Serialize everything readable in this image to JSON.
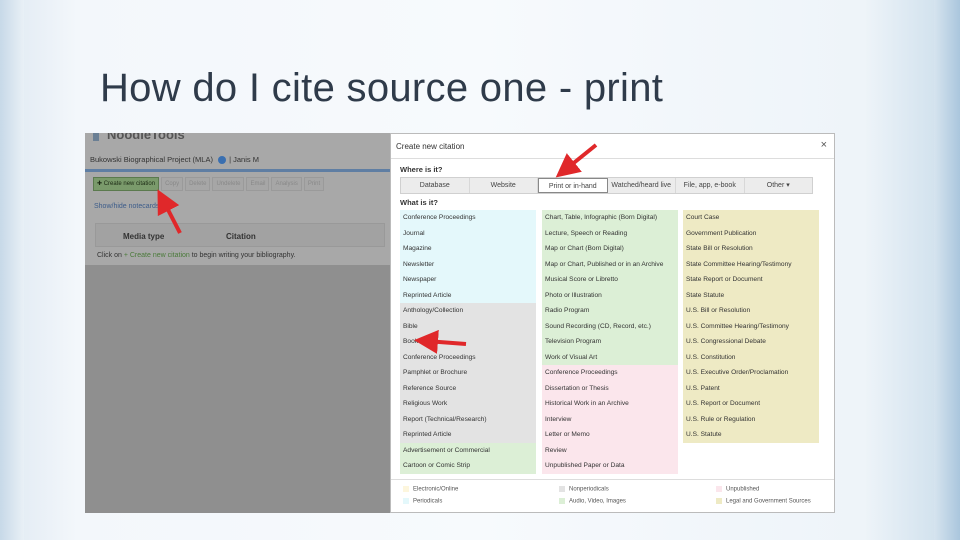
{
  "slide": {
    "title": "How do I cite source one - print"
  },
  "app": {
    "logo": "NoodleTools",
    "project": "Bukowski Biographical Project (MLA)",
    "user": "Janis M",
    "toolbar": [
      "Create new citation",
      "Copy",
      "Delete",
      "Undelete",
      "Email",
      "Analysis",
      "Print"
    ],
    "show_hide": "Show/hide notecards",
    "columns": [
      "Media type",
      "Citation"
    ],
    "hint_before": "Click on ",
    "hint_link": "+ Create new citation",
    "hint_after": " to begin writing your bibliography."
  },
  "dialog": {
    "title": "Create new citation",
    "q_where": "Where is it?",
    "q_what": "What is it?",
    "tabs": [
      "Database",
      "Website",
      "Print or in-hand",
      "Watched/heard live",
      "File, app, e-book",
      "Other ▾"
    ],
    "active_tab": "Print or in-hand",
    "col1": [
      {
        "t": "Conference Proceedings",
        "c": "peri"
      },
      {
        "t": "Journal",
        "c": "peri"
      },
      {
        "t": "Magazine",
        "c": "peri"
      },
      {
        "t": "Newsletter",
        "c": "peri"
      },
      {
        "t": "Newspaper",
        "c": "peri"
      },
      {
        "t": "Reprinted Article",
        "c": "peri"
      },
      {
        "t": "Anthology/Collection",
        "c": "nonp"
      },
      {
        "t": "Bible",
        "c": "nonp"
      },
      {
        "t": "Book",
        "c": "nonp"
      },
      {
        "t": "Conference Proceedings",
        "c": "nonp"
      },
      {
        "t": "Pamphlet or Brochure",
        "c": "nonp"
      },
      {
        "t": "Reference Source",
        "c": "nonp"
      },
      {
        "t": "Religious Work",
        "c": "nonp"
      },
      {
        "t": "Report (Technical/Research)",
        "c": "nonp"
      },
      {
        "t": "Reprinted Article",
        "c": "nonp"
      },
      {
        "t": "Advertisement or Commercial",
        "c": "audio"
      },
      {
        "t": "Cartoon or Comic Strip",
        "c": "audio"
      }
    ],
    "col2": [
      {
        "t": "Chart, Table, Infographic (Born Digital)",
        "c": "audio"
      },
      {
        "t": "Lecture, Speech or Reading",
        "c": "audio"
      },
      {
        "t": "Map or Chart (Born Digital)",
        "c": "audio"
      },
      {
        "t": "Map or Chart, Published or in an Archive",
        "c": "audio"
      },
      {
        "t": "Musical Score or Libretto",
        "c": "audio"
      },
      {
        "t": "Photo or Illustration",
        "c": "audio"
      },
      {
        "t": "Radio Program",
        "c": "audio"
      },
      {
        "t": "Sound Recording (CD, Record, etc.)",
        "c": "audio"
      },
      {
        "t": "Television Program",
        "c": "audio"
      },
      {
        "t": "Work of Visual Art",
        "c": "audio"
      },
      {
        "t": "Conference Proceedings",
        "c": "unpub"
      },
      {
        "t": "Dissertation or Thesis",
        "c": "unpub"
      },
      {
        "t": "Historical Work in an Archive",
        "c": "unpub"
      },
      {
        "t": "Interview",
        "c": "unpub"
      },
      {
        "t": "Letter or Memo",
        "c": "unpub"
      },
      {
        "t": "Review",
        "c": "unpub"
      },
      {
        "t": "Unpublished Paper or Data",
        "c": "unpub"
      }
    ],
    "col3": [
      {
        "t": "Court Case",
        "c": "legal"
      },
      {
        "t": "Government Publication",
        "c": "legal"
      },
      {
        "t": "State Bill or Resolution",
        "c": "legal"
      },
      {
        "t": "State Committee Hearing/Testimony",
        "c": "legal"
      },
      {
        "t": "State Report or Document",
        "c": "legal"
      },
      {
        "t": "State Statute",
        "c": "legal"
      },
      {
        "t": "U.S. Bill or Resolution",
        "c": "legal"
      },
      {
        "t": "U.S. Committee Hearing/Testimony",
        "c": "legal"
      },
      {
        "t": "U.S. Congressional Debate",
        "c": "legal"
      },
      {
        "t": "U.S. Constitution",
        "c": "legal"
      },
      {
        "t": "U.S. Executive Order/Proclamation",
        "c": "legal"
      },
      {
        "t": "U.S. Patent",
        "c": "legal"
      },
      {
        "t": "U.S. Report or Document",
        "c": "legal"
      },
      {
        "t": "U.S. Rule or Regulation",
        "c": "legal"
      },
      {
        "t": "U.S. Statute",
        "c": "legal"
      }
    ],
    "legend": {
      "electronic": "Electronic/Online",
      "periodicals": "Periodicals",
      "nonperiodicals": "Nonperiodicals",
      "audio": "Audio, Video, Images",
      "unpublished": "Unpublished",
      "legal": "Legal and Government Sources"
    }
  },
  "colors": {
    "arrow": "#e0282a",
    "title": "#2f3b4a"
  }
}
